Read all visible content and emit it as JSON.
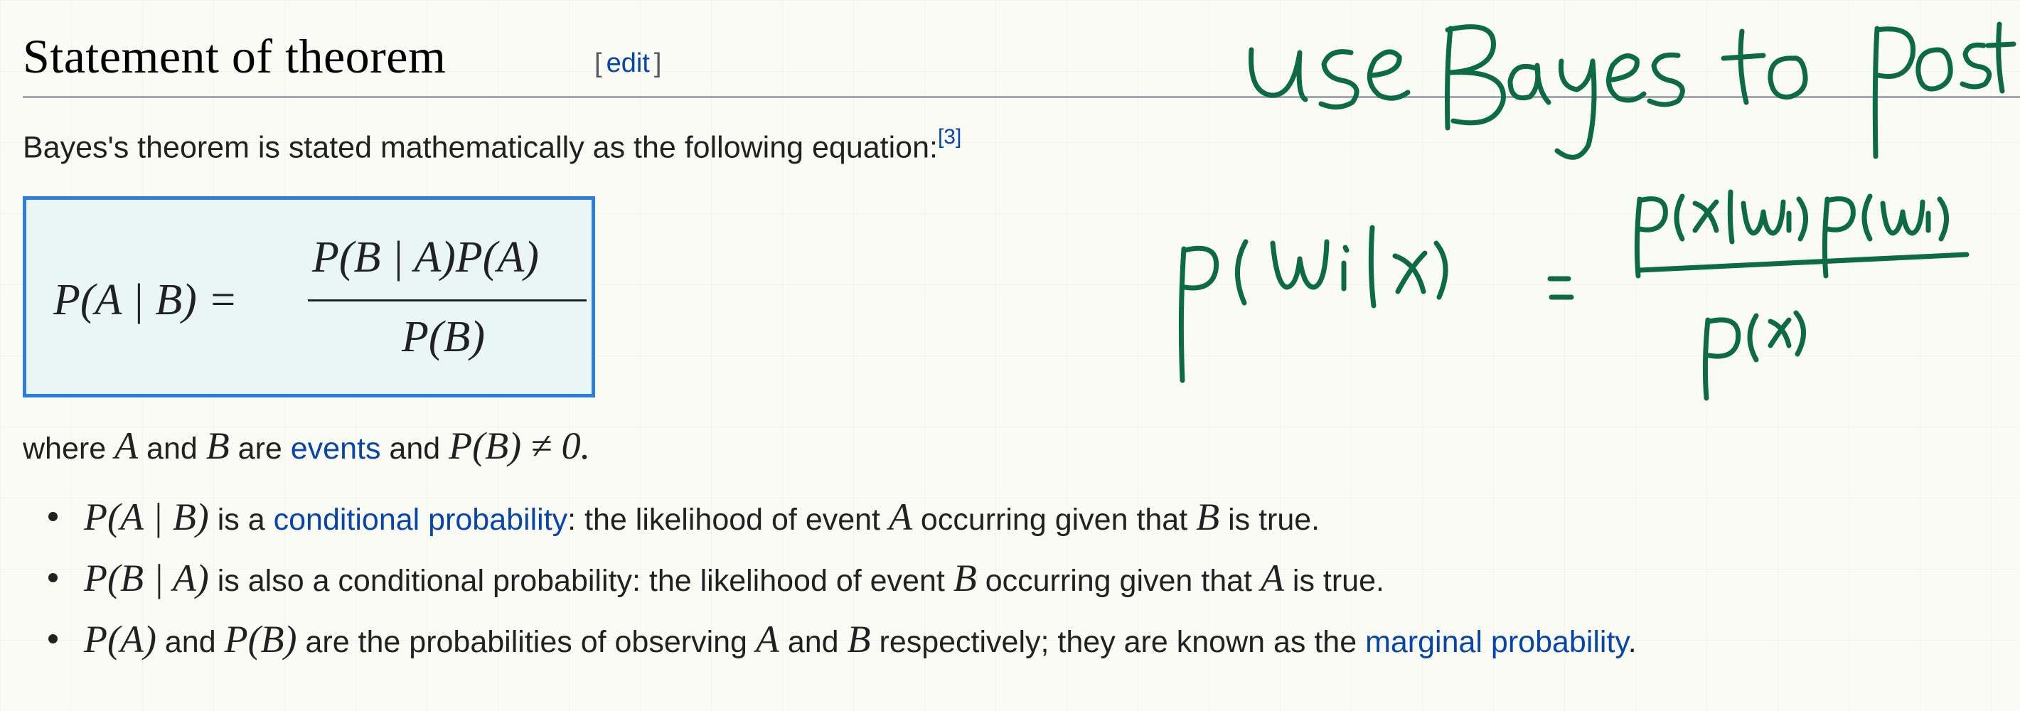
{
  "section": {
    "title": "Statement of theorem",
    "edit_open": "[",
    "edit_label": "edit",
    "edit_close": "]"
  },
  "intro": {
    "text": "Bayes's theorem is stated mathematically as the following equation:",
    "citation": "[3]"
  },
  "formula": {
    "left": "P(A | B) =",
    "numerator": "P(B | A)P(A)",
    "denominator": "P(B)"
  },
  "where": {
    "prefix": "where ",
    "var_a": "A",
    "and1": " and ",
    "var_b": "B",
    "are": " are ",
    "events_link": "events",
    "and2": " and ",
    "condition": "P(B) ≠ 0."
  },
  "bullets": [
    {
      "math": "P(A | B)",
      "text1": " is a ",
      "link": "conditional probability",
      "text2": ": the likelihood of event ",
      "var1": "A",
      "text3": " occurring given that ",
      "var2": "B",
      "text4": " is true."
    },
    {
      "math": "P(B | A)",
      "text1": " is also a conditional probability: the likelihood of event ",
      "var1": "B",
      "text3": " occurring given that ",
      "var2": "A",
      "text4": " is true."
    },
    {
      "math": "P(A)",
      "text1": " and ",
      "math2": "P(B)",
      "text2": " are the probabilities of observing ",
      "var1": "A",
      "text3": " and ",
      "var2": "B",
      "text4": " respectively; they are known as the ",
      "link": "marginal probability",
      "text5": "."
    }
  ],
  "handwriting": {
    "note": "use Bayes to posterior",
    "formula": "p(wi|x) = p(x|wi)p(wi) / p(x)",
    "ink_color": "#0c6b44"
  },
  "colors": {
    "link": "#0645ad",
    "formula_border": "#2a7de1",
    "formula_background": "#eaf6f4"
  }
}
